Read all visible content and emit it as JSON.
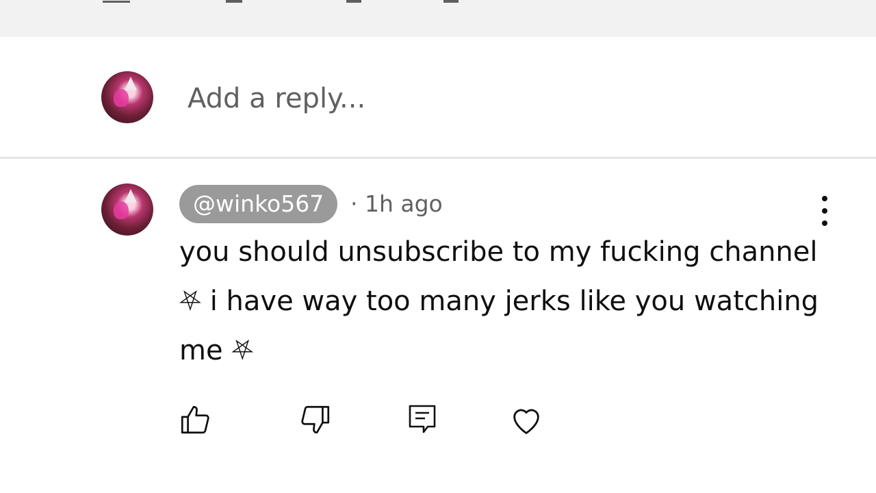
{
  "reply": {
    "placeholder": "Add a reply..."
  },
  "comment": {
    "handle": "@winko567",
    "meta": "· 1h ago",
    "text": "you should unsubscribe to my fucking channel ⛧ i have way too many jerks like you watching me ⛧"
  },
  "actions": {
    "like_icon": "thumb-up-icon",
    "dislike_icon": "thumb-down-icon",
    "reply_icon": "comment-icon",
    "heart_icon": "heart-icon"
  },
  "colors": {
    "top_strip": "#f2f2f2",
    "handle_pill": "#9a9a9a",
    "secondary_text": "#606060",
    "divider": "#e5e5e5"
  }
}
